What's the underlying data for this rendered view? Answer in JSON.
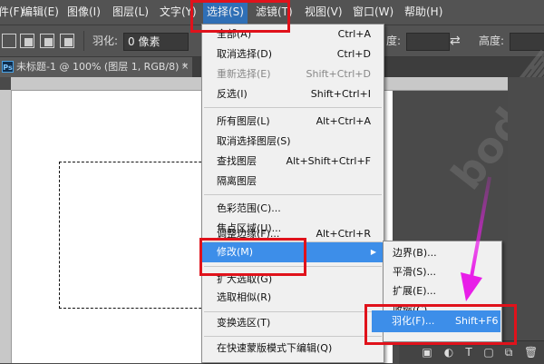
{
  "menubar": {
    "items": [
      {
        "label": "件(F)"
      },
      {
        "label": "编辑(E)"
      },
      {
        "label": "图像(I)"
      },
      {
        "label": "图层(L)"
      },
      {
        "label": "文字(Y)"
      },
      {
        "label": "选择(S)"
      },
      {
        "label": "滤镜(T)"
      },
      {
        "label": "视图(V)"
      },
      {
        "label": "窗口(W)"
      },
      {
        "label": "帮助(H)"
      }
    ]
  },
  "options": {
    "feather_label": "羽化:",
    "feather_value": "0 像素",
    "label_du": "度:",
    "label_height": "高度:"
  },
  "document": {
    "tab_title": "未标题-1 @ 100% (图层 1, RGB/8) *",
    "close_glyph": "×",
    "ps_icon": "Ps"
  },
  "watermark": "body夏",
  "select_menu": {
    "items": [
      {
        "label": "全部(A)",
        "shortcut": "Ctrl+A",
        "disabled": false
      },
      {
        "label": "取消选择(D)",
        "shortcut": "Ctrl+D",
        "disabled": false
      },
      {
        "label": "重新选择(E)",
        "shortcut": "Shift+Ctrl+D",
        "disabled": true
      },
      {
        "label": "反选(I)",
        "shortcut": "Shift+Ctrl+I",
        "disabled": false
      },
      {
        "label": "所有图层(L)",
        "shortcut": "Alt+Ctrl+A",
        "disabled": false
      },
      {
        "label": "取消选择图层(S)",
        "shortcut": "",
        "disabled": false
      },
      {
        "label": "查找图层",
        "shortcut": "Alt+Shift+Ctrl+F",
        "disabled": false
      },
      {
        "label": "隔离图层",
        "shortcut": "",
        "disabled": false
      },
      {
        "label": "色彩范围(C)...",
        "shortcut": "",
        "disabled": false
      },
      {
        "label": "焦点区域(U)...",
        "shortcut": "",
        "disabled": false
      },
      {
        "label": "调整边缘(F)...",
        "shortcut": "Alt+Ctrl+R",
        "disabled": false
      },
      {
        "label": "修改(M)",
        "shortcut": "",
        "disabled": false
      },
      {
        "label": "扩大选取(G)",
        "shortcut": "",
        "disabled": false
      },
      {
        "label": "选取相似(R)",
        "shortcut": "",
        "disabled": false
      },
      {
        "label": "变换选区(T)",
        "shortcut": "",
        "disabled": false
      },
      {
        "label": "在快速蒙版模式下编辑(Q)",
        "shortcut": "",
        "disabled": false
      }
    ]
  },
  "modify_submenu": {
    "items": [
      {
        "label": "边界(B)...",
        "shortcut": ""
      },
      {
        "label": "平滑(S)...",
        "shortcut": ""
      },
      {
        "label": "扩展(E)...",
        "shortcut": ""
      },
      {
        "label": "收缩(C)...",
        "shortcut": ""
      },
      {
        "label": "羽化(F)...",
        "shortcut": "Shift+F6"
      }
    ]
  },
  "colors": {
    "highlight": "#3d8ee9",
    "annotation_red": "#e0121b",
    "arrow_magenta": "#e81ee8"
  },
  "icons": [
    "close-icon",
    "submenu-arrow-icon",
    "new-selection-icon",
    "add-selection-icon",
    "subtract-selection-icon",
    "intersect-selection-icon",
    "swap-icon",
    "lock-icon",
    "trash-icon",
    "text-tool-icon"
  ]
}
